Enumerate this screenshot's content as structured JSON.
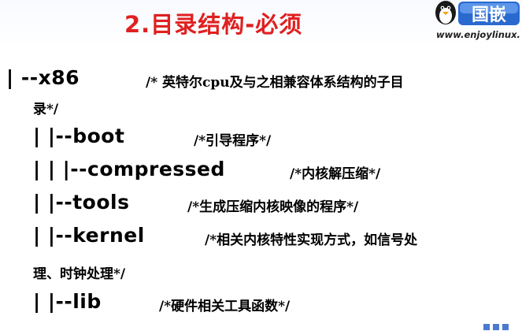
{
  "slide": {
    "title": "2.目录结构-必须",
    "logo_text": "国嵌",
    "logo_url": "www.enjoylinux.",
    "lines": [
      {
        "path": "| --x86",
        "comment": "/* 英特尔cpu及与之相兼容体系结构的子目",
        "continuation": "录*/"
      },
      {
        "path": "| |--boot",
        "comment": "/*引导程序*/"
      },
      {
        "path": "| | |--compressed",
        "comment": "/*内核解压缩*/"
      },
      {
        "path": "| |--tools",
        "comment": "/*生成压缩内核映像的程序*/"
      },
      {
        "path": "| |--kernel",
        "comment": "/*相关内核特性实现方式，如信号处",
        "continuation": "理、时钟处理*/"
      },
      {
        "path": "| |--lib",
        "comment": "/*硬件相关工具函数*/"
      }
    ]
  }
}
